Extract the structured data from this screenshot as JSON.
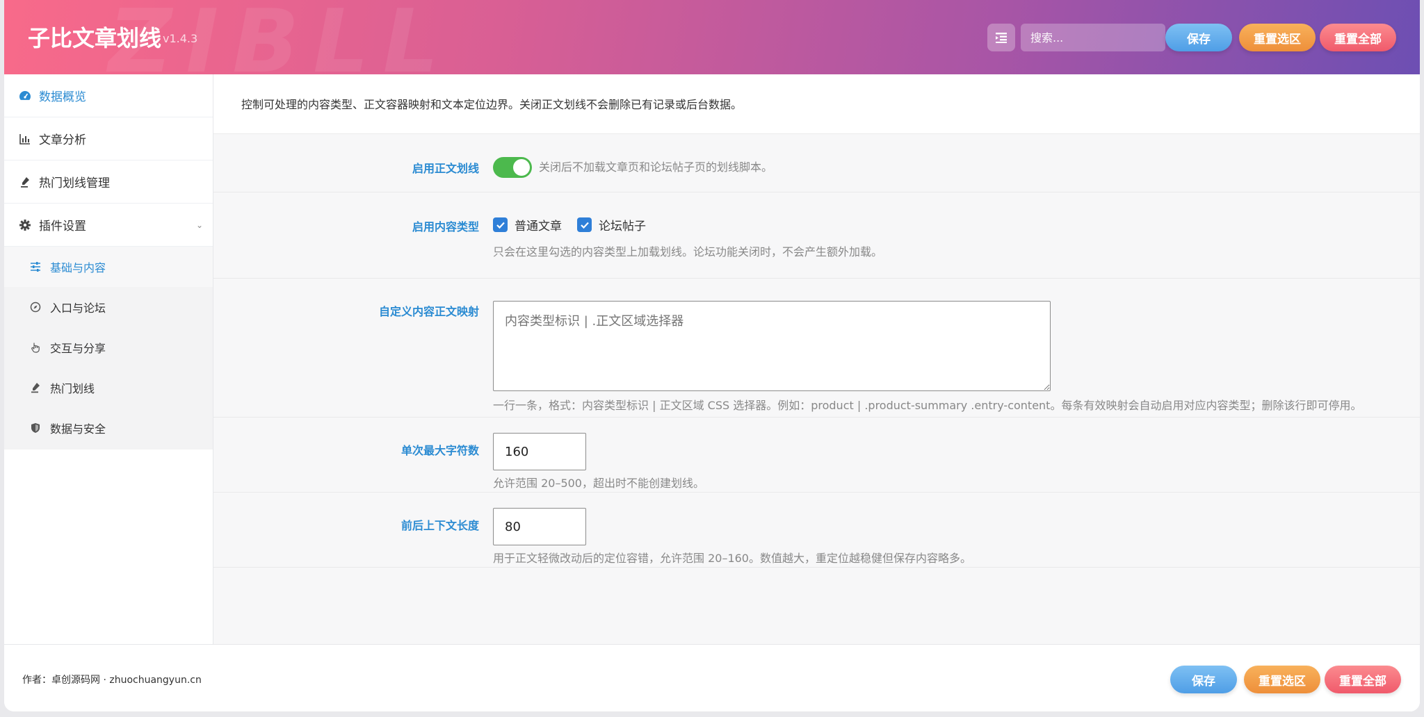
{
  "header": {
    "watermark": "ZIBLL",
    "title": "子比文章划线",
    "version": "v1.4.3",
    "search_placeholder": "搜索...",
    "save_label": "保存",
    "reset_section_label": "重置选区",
    "reset_all_label": "重置全部"
  },
  "sidebar": {
    "items": [
      {
        "label": "数据概览",
        "icon": "dashboard-icon"
      },
      {
        "label": "文章分析",
        "icon": "bar-chart-icon"
      },
      {
        "label": "热门划线管理",
        "icon": "highlighter-icon"
      },
      {
        "label": "插件设置",
        "icon": "gear-icon"
      }
    ],
    "subitems": [
      {
        "label": "基础与内容",
        "icon": "sliders-icon"
      },
      {
        "label": "入口与论坛",
        "icon": "compass-icon"
      },
      {
        "label": "交互与分享",
        "icon": "pointer-hand-icon"
      },
      {
        "label": "热门划线",
        "icon": "highlighter-icon"
      },
      {
        "label": "数据与安全",
        "icon": "shield-icon"
      }
    ]
  },
  "main": {
    "intro": "控制可处理的内容类型、正文容器映射和文本定位边界。关闭正文划线不会删除已有记录或后台数据。",
    "enable_highlight": {
      "label": "启用正文划线",
      "enabled": true,
      "desc": "关闭后不加载文章页和论坛帖子页的划线脚本。"
    },
    "content_types": {
      "label": "启用内容类型",
      "options": [
        {
          "label": "普通文章",
          "checked": true
        },
        {
          "label": "论坛帖子",
          "checked": true
        }
      ],
      "desc": "只会在这里勾选的内容类型上加载划线。论坛功能关闭时，不会产生额外加载。"
    },
    "custom_mapping": {
      "label": "自定义内容正文映射",
      "placeholder": "内容类型标识 | .正文区域选择器",
      "desc": "一行一条，格式：内容类型标识 | 正文区域 CSS 选择器。例如：product | .product-summary .entry-content。每条有效映射会自动启用对应内容类型；删除该行即可停用。"
    },
    "max_chars": {
      "label": "单次最大字符数",
      "value": "160",
      "desc": "允许范围 20–500，超出时不能创建划线。"
    },
    "context_length": {
      "label": "前后上下文长度",
      "value": "80",
      "desc": "用于正文轻微改动后的定位容错，允许范围 20–160。数值越大，重定位越稳健但保存内容略多。"
    }
  },
  "footer": {
    "author": "作者：卓创源码网 · zhuochuangyun.cn",
    "save_label": "保存",
    "reset_section_label": "重置选区",
    "reset_all_label": "重置全部"
  },
  "colors": {
    "accent": "#2b8bd2",
    "toggle_on": "#4cb94d",
    "header_gradient_start": "#f86a8a",
    "header_gradient_end": "#6d4fb3"
  }
}
